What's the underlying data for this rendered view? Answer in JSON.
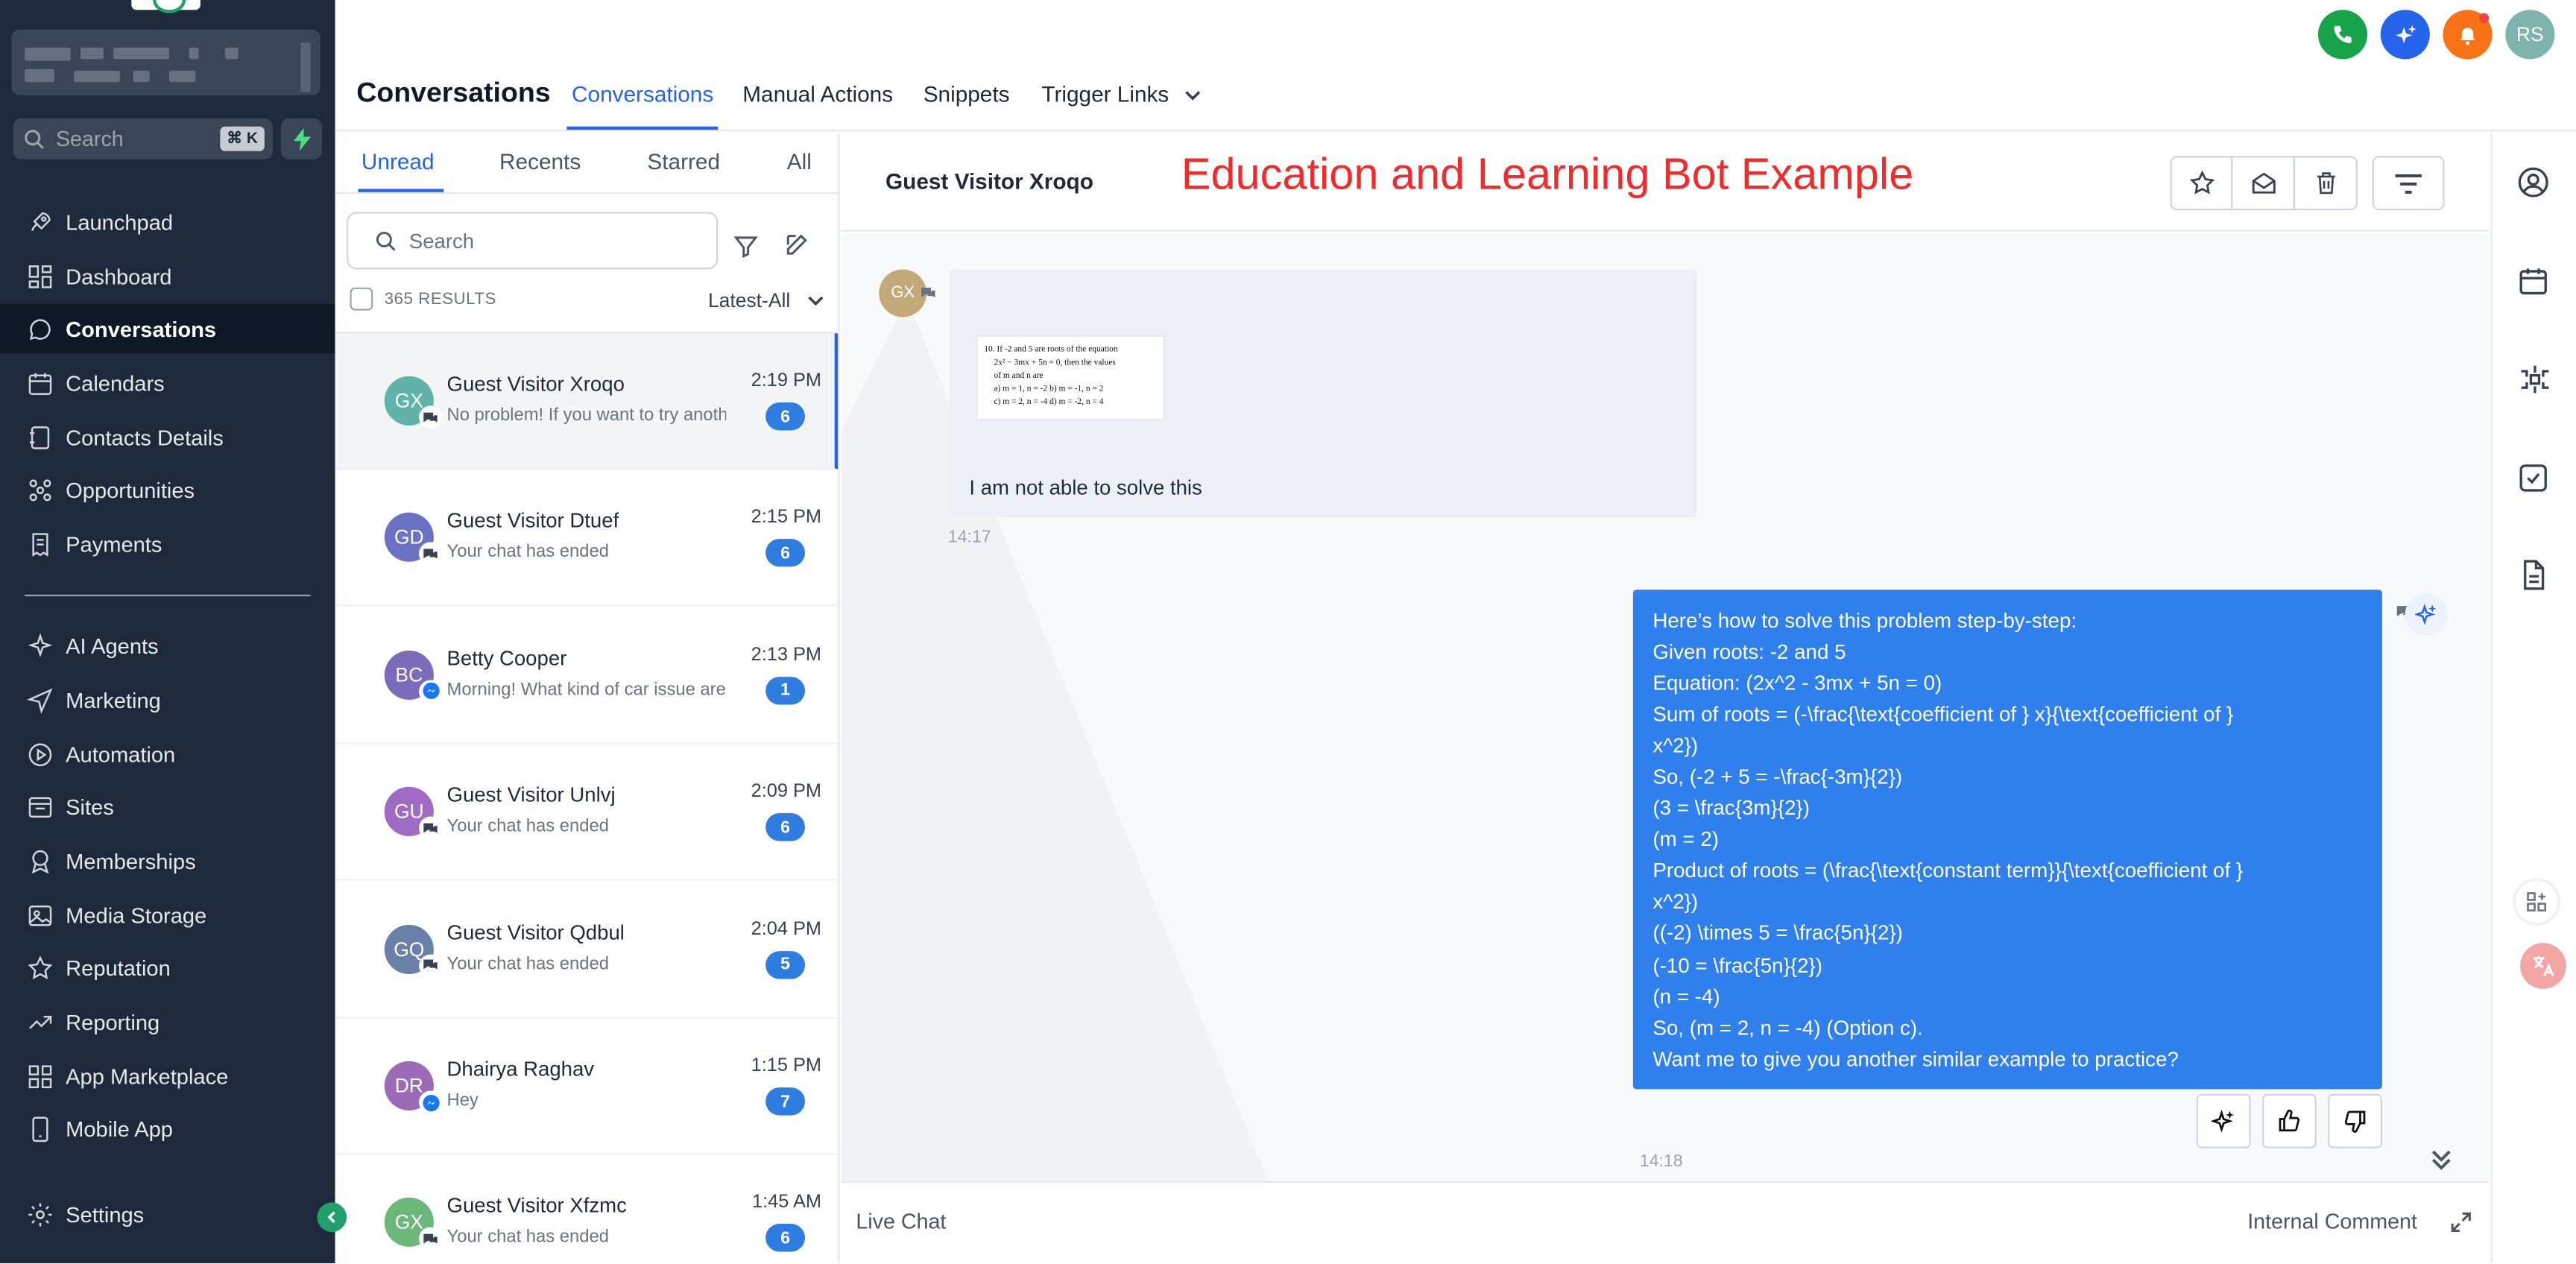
{
  "sidebar": {
    "search_placeholder": "Search",
    "search_shortcut": "⌘ K",
    "items": [
      {
        "label": "Launchpad",
        "icon": "rocket-icon"
      },
      {
        "label": "Dashboard",
        "icon": "grid-icon"
      },
      {
        "label": "Conversations",
        "icon": "chat-bubble-icon",
        "active": true
      },
      {
        "label": "Calendars",
        "icon": "calendar-icon"
      },
      {
        "label": "Contacts Details",
        "icon": "contacts-book-icon"
      },
      {
        "label": "Opportunities",
        "icon": "pipeline-icon"
      },
      {
        "label": "Payments",
        "icon": "receipt-icon"
      },
      {
        "label": "AI Agents",
        "icon": "sparkle-icon"
      },
      {
        "label": "Marketing",
        "icon": "send-icon"
      },
      {
        "label": "Automation",
        "icon": "play-circle-icon"
      },
      {
        "label": "Sites",
        "icon": "browser-icon"
      },
      {
        "label": "Memberships",
        "icon": "badge-icon"
      },
      {
        "label": "Media Storage",
        "icon": "image-icon"
      },
      {
        "label": "Reputation",
        "icon": "star-icon"
      },
      {
        "label": "Reporting",
        "icon": "trend-icon"
      },
      {
        "label": "App Marketplace",
        "icon": "apps-icon"
      },
      {
        "label": "Mobile App",
        "icon": "phone-icon"
      },
      {
        "label": "Settings",
        "icon": "gear-icon"
      }
    ]
  },
  "topbar": {
    "title": "Conversations",
    "tabs": [
      "Conversations",
      "Manual Actions",
      "Snippets",
      "Trigger Links"
    ],
    "user_initials": "RS"
  },
  "list": {
    "tabs": [
      "Unread",
      "Recents",
      "Starred",
      "All"
    ],
    "search_placeholder": "Search",
    "results": "365 RESULTS",
    "sort": "Latest-All",
    "conversations": [
      {
        "initials": "GX",
        "name": "Guest Visitor Xroqo",
        "preview": "No problem! If you want to try another",
        "time": "2:19 PM",
        "count": "6",
        "color": "#5fb3a8",
        "channel": "chat"
      },
      {
        "initials": "GD",
        "name": "Guest Visitor Dtuef",
        "preview": "Your chat has ended",
        "time": "2:15 PM",
        "count": "6",
        "color": "#6b72c4",
        "channel": "chat"
      },
      {
        "initials": "BC",
        "name": "Betty Cooper",
        "preview": "Morning! What kind of car issue are you",
        "time": "2:13 PM",
        "count": "1",
        "color": "#7c6bb8",
        "channel": "messenger"
      },
      {
        "initials": "GU",
        "name": "Guest Visitor Unlvj",
        "preview": "Your chat has ended",
        "time": "2:09 PM",
        "count": "6",
        "color": "#a06bc4",
        "channel": "chat"
      },
      {
        "initials": "GQ",
        "name": "Guest Visitor Qdbul",
        "preview": "Your chat has ended",
        "time": "2:04 PM",
        "count": "5",
        "color": "#6b80a8",
        "channel": "chat"
      },
      {
        "initials": "DR",
        "name": "Dhairya Raghav",
        "preview": "Hey",
        "time": "1:15 PM",
        "count": "7",
        "color": "#9b6bb8",
        "channel": "messenger"
      },
      {
        "initials": "GX",
        "name": "Guest Visitor Xfzmc",
        "preview": "Your chat has ended",
        "time": "1:45 AM",
        "count": "6",
        "color": "#6bb87a",
        "channel": "chat"
      }
    ]
  },
  "chat": {
    "contact_name": "Guest Visitor Xroqo",
    "overlay_title": "Education and Learning Bot Example",
    "incoming": {
      "avatar": "GX",
      "image_lines": [
        "10. If -2 and 5 are roots of the equation",
        "2x² − 3mx + 5n = 0, then the values",
        "of m and n are",
        "a)  m = 1, n = -2        b) m = -1, n = 2",
        "c)  m = 2, n = -4        d) m = -2, n = 4"
      ],
      "text": "I am not able to solve this",
      "time": "14:17"
    },
    "outgoing": {
      "lines": [
        "Here’s how to solve this problem step-by-step:",
        "Given roots: -2 and 5",
        "Equation: (2x^2 - 3mx + 5n = 0)",
        "Sum of roots = (-\\frac{\\text{coefficient of } x}{\\text{coefficient of }",
        "x^2})",
        "So, (-2 + 5 = -\\frac{-3m}{2})",
        "(3 = \\frac{3m}{2})",
        "(m = 2)",
        "Product of roots = (\\frac{\\text{constant term}}{\\text{coefficient of }",
        "x^2})",
        "((-2) \\times 5 = \\frac{5n}{2})",
        "(-10 = \\frac{5n}{2})",
        "(n = -4)",
        "So, (m = 2, n = -4) (Option c).",
        "Want me to give you another similar example to practice?"
      ],
      "time": "14:18"
    },
    "footer": {
      "left_tab": "Live Chat",
      "right_tab": "Internal Comment"
    }
  },
  "colors": {
    "sidebar_bg": "#1e2a3b",
    "accent": "#2563eb",
    "outgoing_bubble": "#2f80ed",
    "overlay_text": "#ef2b2b",
    "phone_button": "#16a34a",
    "notification_button": "#f97316"
  }
}
